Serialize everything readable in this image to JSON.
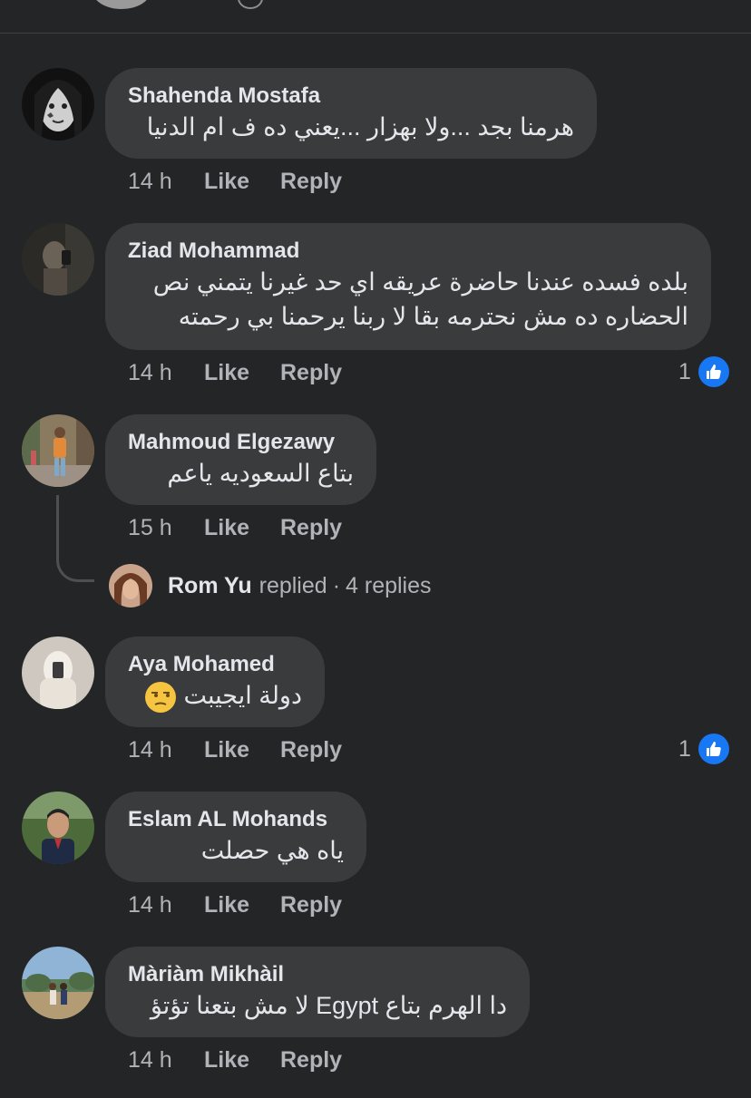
{
  "comments": [
    {
      "author": "Shahenda Mostafa",
      "text": "هرمنا بجد ...ولا بهزار ...يعني ده ف ام الدنيا",
      "time": "14 h",
      "like_label": "Like",
      "reply_label": "Reply"
    },
    {
      "author": "Ziad Mohammad",
      "text_line1": "بلده فسده عندنا حاضرة عريقه اي حد غيرنا يتمني نص",
      "text_line2": "الحضاره ده مش نحترمه بقا لا ربنا يرحمنا بي رحمته",
      "time": "14 h",
      "like_label": "Like",
      "reply_label": "Reply",
      "reaction_count": "1"
    },
    {
      "author": "Mahmoud Elgezawy",
      "text": "بتاع السعوديه ياعم",
      "time": "15 h",
      "like_label": "Like",
      "reply_label": "Reply",
      "replies": {
        "replier": "Rom Yu",
        "replied_word": "replied",
        "separator": "·",
        "count_label": "4 replies"
      }
    },
    {
      "author": "Aya Mohamed",
      "text": "دولة ايجيبت",
      "emoji": "unamused-face",
      "time": "14 h",
      "like_label": "Like",
      "reply_label": "Reply",
      "reaction_count": "1"
    },
    {
      "author": "Eslam AL Mohands",
      "text": "ياه هي حصلت",
      "time": "14 h",
      "like_label": "Like",
      "reply_label": "Reply"
    },
    {
      "author": "Màriàm Mikhàil",
      "text": "دا الهرم بتاع Egypt لا مش بتعنا تؤتؤ",
      "time": "14 h",
      "like_label": "Like",
      "reply_label": "Reply"
    }
  ],
  "colors": {
    "background": "#242526",
    "bubble": "#3a3b3c",
    "text": "#e4e6eb",
    "muted": "#b0b3b8",
    "like_blue": "#1877f2"
  },
  "icons": {
    "reaction": "thumbs-up-icon"
  }
}
